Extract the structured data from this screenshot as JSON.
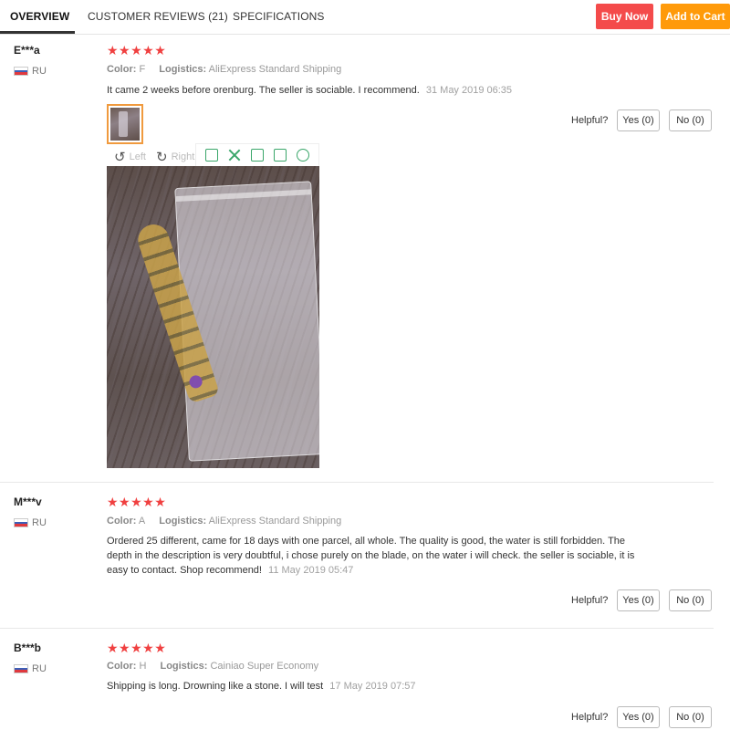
{
  "tabs": [
    {
      "label": "OVERVIEW",
      "active": true
    },
    {
      "label": "CUSTOMER REVIEWS (21)",
      "active": false
    },
    {
      "label": "SPECIFICATIONS",
      "active": false
    }
  ],
  "actions": {
    "buy_now": "Buy Now",
    "add_to_cart": "Add to Cart"
  },
  "colors": {
    "buy_now": "#f44b4b",
    "add_to_cart": "#ff9a0a",
    "stars": "#f04040",
    "selected_thumb_border": "#f09a3e",
    "toolbar_icons": "#3aa66a"
  },
  "labels": {
    "color": "Color:",
    "logistics": "Logistics:",
    "helpful": "Helpful?"
  },
  "image_viewer": {
    "rotate_left": "Left",
    "rotate_right": "Right",
    "toolbar_icons": [
      "phone-icon",
      "expand-icon",
      "save-icon",
      "share-icon",
      "settings-icon"
    ]
  },
  "reviews": [
    {
      "name": "E***a",
      "country": "RU",
      "rating": 5,
      "stars": "★★★★★",
      "color": "F",
      "logistics": "AliExpress Standard Shipping",
      "text": "It came 2 weeks before orenburg. The seller is sociable. I recommend.",
      "date": "31 May 2019 06:35",
      "yes": "Yes (0)",
      "no": "No (0)",
      "has_photo": true
    },
    {
      "name": "M***v",
      "country": "RU",
      "rating": 5,
      "stars": "★★★★★",
      "color": "A",
      "logistics": "AliExpress Standard Shipping",
      "text": "Ordered 25 different, came for 18 days with one parcel, all whole. The quality is good, the water is still forbidden. The depth in the description is very doubtful, i chose purely on the blade, on the water i will check. the seller is sociable, it is easy to contact. Shop recommend!",
      "date": "11 May 2019 05:47",
      "yes": "Yes (0)",
      "no": "No (0)",
      "has_photo": false
    },
    {
      "name": "B***b",
      "country": "RU",
      "rating": 5,
      "stars": "★★★★★",
      "color": "H",
      "logistics": "Cainiao Super Economy",
      "text": "Shipping is long. Drowning like a stone. I will test",
      "date": "17 May 2019 07:57",
      "yes": "Yes (0)",
      "no": "No (0)",
      "has_photo": false
    }
  ]
}
